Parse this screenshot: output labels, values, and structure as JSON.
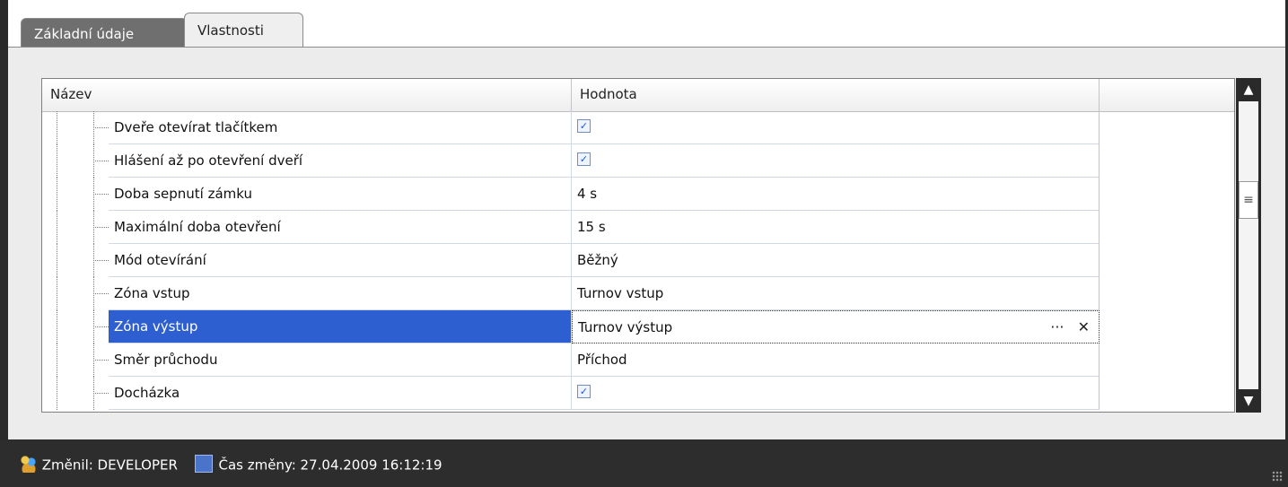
{
  "tabs": [
    {
      "label": "Základní údaje"
    },
    {
      "label": "Vlastnosti"
    }
  ],
  "grid": {
    "columns": [
      "Název",
      "Hodnota"
    ],
    "rows": [
      {
        "name": "Dveře otevírat tlačítkem",
        "value_type": "checkbox",
        "checked": true,
        "value": ""
      },
      {
        "name": "Hlášení až po otevření dveří",
        "value_type": "checkbox",
        "checked": true,
        "value": ""
      },
      {
        "name": "Doba sepnutí zámku",
        "value_type": "text",
        "value": "4 s"
      },
      {
        "name": "Maximální doba otevření",
        "value_type": "text",
        "value": "15 s"
      },
      {
        "name": "Mód otevírání",
        "value_type": "text",
        "value": "Běžný"
      },
      {
        "name": "Zóna vstup",
        "value_type": "text",
        "value": "Turnov vstup"
      },
      {
        "name": "Zóna výstup",
        "value_type": "text",
        "value": "Turnov výstup"
      },
      {
        "name": "Směr průchodu",
        "value_type": "text",
        "value": "Příchod"
      },
      {
        "name": "Docházka",
        "value_type": "checkbox",
        "checked": true,
        "value": ""
      }
    ],
    "editor": {
      "ellipsis_label": "···",
      "clear_label": "✕"
    }
  },
  "scrollbar": {
    "up_icon": "▲",
    "down_icon": "▼",
    "thumb_grip": "≡"
  },
  "status": {
    "changed_by": "Změnil: DEVELOPER",
    "changed_time": "Čas změny: 27.04.2009 16:12:19",
    "users_icon": "users-icon",
    "time_icon": "calendar-clock-icon"
  },
  "colors": {
    "selection": "#2d5fd1",
    "frame": "#2a2a2a"
  }
}
